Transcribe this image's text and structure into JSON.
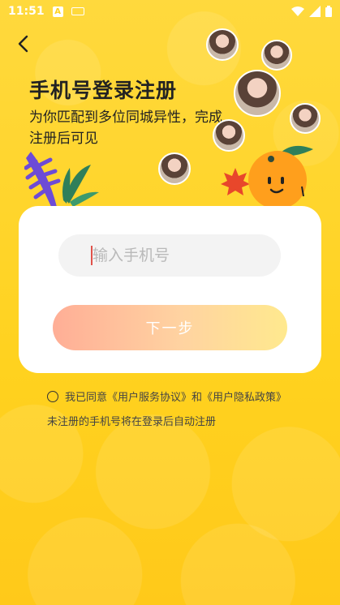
{
  "status_bar": {
    "time": "11:51",
    "icon_a": "A"
  },
  "header": {
    "title": "手机号登录注册",
    "subtitle": "为你匹配到多位同城异性，完成注册后可见"
  },
  "form": {
    "phone_placeholder": "输入手机号",
    "next_label": "下一步"
  },
  "agreement": {
    "prefix": "我已同意",
    "user_agreement": "《用户服务协议》",
    "and": "和",
    "privacy_policy": "《用户隐私政策》",
    "note": "未注册的手机号将在登录后自动注册"
  },
  "colors": {
    "background": "#ffd21f",
    "button_gradient_start": "#ffae96",
    "button_gradient_end": "#ffe98e"
  },
  "icons": [
    "back-arrow-icon",
    "wifi-icon",
    "signal-icon",
    "battery-icon",
    "orange-mascot-icon",
    "leaf-icon",
    "maple-leaf-icon"
  ]
}
